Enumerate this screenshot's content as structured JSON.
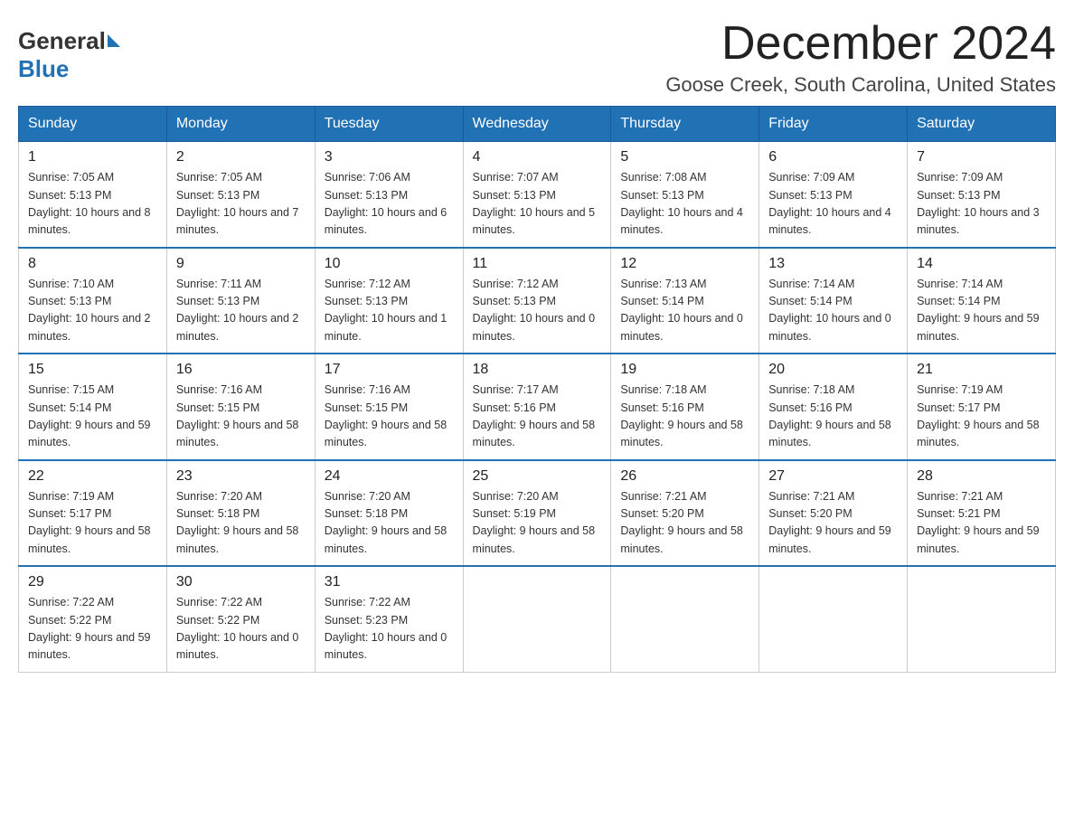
{
  "header": {
    "logo_general": "General",
    "logo_blue": "Blue",
    "month_title": "December 2024",
    "location": "Goose Creek, South Carolina, United States"
  },
  "days_of_week": [
    "Sunday",
    "Monday",
    "Tuesday",
    "Wednesday",
    "Thursday",
    "Friday",
    "Saturday"
  ],
  "weeks": [
    [
      {
        "day": "1",
        "sunrise": "7:05 AM",
        "sunset": "5:13 PM",
        "daylight": "10 hours and 8 minutes."
      },
      {
        "day": "2",
        "sunrise": "7:05 AM",
        "sunset": "5:13 PM",
        "daylight": "10 hours and 7 minutes."
      },
      {
        "day": "3",
        "sunrise": "7:06 AM",
        "sunset": "5:13 PM",
        "daylight": "10 hours and 6 minutes."
      },
      {
        "day": "4",
        "sunrise": "7:07 AM",
        "sunset": "5:13 PM",
        "daylight": "10 hours and 5 minutes."
      },
      {
        "day": "5",
        "sunrise": "7:08 AM",
        "sunset": "5:13 PM",
        "daylight": "10 hours and 4 minutes."
      },
      {
        "day": "6",
        "sunrise": "7:09 AM",
        "sunset": "5:13 PM",
        "daylight": "10 hours and 4 minutes."
      },
      {
        "day": "7",
        "sunrise": "7:09 AM",
        "sunset": "5:13 PM",
        "daylight": "10 hours and 3 minutes."
      }
    ],
    [
      {
        "day": "8",
        "sunrise": "7:10 AM",
        "sunset": "5:13 PM",
        "daylight": "10 hours and 2 minutes."
      },
      {
        "day": "9",
        "sunrise": "7:11 AM",
        "sunset": "5:13 PM",
        "daylight": "10 hours and 2 minutes."
      },
      {
        "day": "10",
        "sunrise": "7:12 AM",
        "sunset": "5:13 PM",
        "daylight": "10 hours and 1 minute."
      },
      {
        "day": "11",
        "sunrise": "7:12 AM",
        "sunset": "5:13 PM",
        "daylight": "10 hours and 0 minutes."
      },
      {
        "day": "12",
        "sunrise": "7:13 AM",
        "sunset": "5:14 PM",
        "daylight": "10 hours and 0 minutes."
      },
      {
        "day": "13",
        "sunrise": "7:14 AM",
        "sunset": "5:14 PM",
        "daylight": "10 hours and 0 minutes."
      },
      {
        "day": "14",
        "sunrise": "7:14 AM",
        "sunset": "5:14 PM",
        "daylight": "9 hours and 59 minutes."
      }
    ],
    [
      {
        "day": "15",
        "sunrise": "7:15 AM",
        "sunset": "5:14 PM",
        "daylight": "9 hours and 59 minutes."
      },
      {
        "day": "16",
        "sunrise": "7:16 AM",
        "sunset": "5:15 PM",
        "daylight": "9 hours and 58 minutes."
      },
      {
        "day": "17",
        "sunrise": "7:16 AM",
        "sunset": "5:15 PM",
        "daylight": "9 hours and 58 minutes."
      },
      {
        "day": "18",
        "sunrise": "7:17 AM",
        "sunset": "5:16 PM",
        "daylight": "9 hours and 58 minutes."
      },
      {
        "day": "19",
        "sunrise": "7:18 AM",
        "sunset": "5:16 PM",
        "daylight": "9 hours and 58 minutes."
      },
      {
        "day": "20",
        "sunrise": "7:18 AM",
        "sunset": "5:16 PM",
        "daylight": "9 hours and 58 minutes."
      },
      {
        "day": "21",
        "sunrise": "7:19 AM",
        "sunset": "5:17 PM",
        "daylight": "9 hours and 58 minutes."
      }
    ],
    [
      {
        "day": "22",
        "sunrise": "7:19 AM",
        "sunset": "5:17 PM",
        "daylight": "9 hours and 58 minutes."
      },
      {
        "day": "23",
        "sunrise": "7:20 AM",
        "sunset": "5:18 PM",
        "daylight": "9 hours and 58 minutes."
      },
      {
        "day": "24",
        "sunrise": "7:20 AM",
        "sunset": "5:18 PM",
        "daylight": "9 hours and 58 minutes."
      },
      {
        "day": "25",
        "sunrise": "7:20 AM",
        "sunset": "5:19 PM",
        "daylight": "9 hours and 58 minutes."
      },
      {
        "day": "26",
        "sunrise": "7:21 AM",
        "sunset": "5:20 PM",
        "daylight": "9 hours and 58 minutes."
      },
      {
        "day": "27",
        "sunrise": "7:21 AM",
        "sunset": "5:20 PM",
        "daylight": "9 hours and 59 minutes."
      },
      {
        "day": "28",
        "sunrise": "7:21 AM",
        "sunset": "5:21 PM",
        "daylight": "9 hours and 59 minutes."
      }
    ],
    [
      {
        "day": "29",
        "sunrise": "7:22 AM",
        "sunset": "5:22 PM",
        "daylight": "9 hours and 59 minutes."
      },
      {
        "day": "30",
        "sunrise": "7:22 AM",
        "sunset": "5:22 PM",
        "daylight": "10 hours and 0 minutes."
      },
      {
        "day": "31",
        "sunrise": "7:22 AM",
        "sunset": "5:23 PM",
        "daylight": "10 hours and 0 minutes."
      },
      null,
      null,
      null,
      null
    ]
  ],
  "labels": {
    "sunrise": "Sunrise:",
    "sunset": "Sunset:",
    "daylight": "Daylight:"
  }
}
